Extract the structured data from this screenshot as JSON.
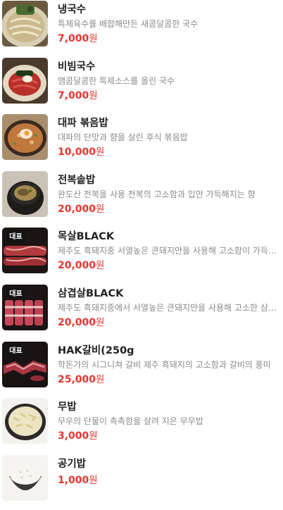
{
  "menu": {
    "items": [
      {
        "name": "냉국수",
        "description": "특제육수를 배합해만든 새콤달콤한 국수",
        "price": "7,000",
        "currency": "원",
        "badge": "",
        "image": "cold-noodle-photo"
      },
      {
        "name": "비빔국수",
        "description": "맴콤달콤한 특제소스를 올린 국수",
        "price": "7,000",
        "currency": "원",
        "badge": "",
        "image": "spicy-noodle-photo"
      },
      {
        "name": "대파 볶음밥",
        "description": "대파의 단맛과 향을 살린 후식 볶음밥",
        "price": "10,000",
        "currency": "원",
        "badge": "",
        "image": "fried-rice-photo"
      },
      {
        "name": "전복솥밥",
        "description": "완도산 전복을 사용 전복의 고소함과 입안 가득해지는 향",
        "price": "20,000",
        "currency": "원",
        "badge": "",
        "image": "abalone-pot-rice-photo"
      },
      {
        "name": "목살BLACK",
        "description": "제주도 흑돼지중 서열높은 큰돼지만을 사용해 고소함이 가득한 목살",
        "price": "20,000",
        "currency": "원",
        "badge": "대표",
        "image": "pork-neck-photo"
      },
      {
        "name": "삼겹살BLACK",
        "description": "제주도 흑돼지중에서 서열높은 큰돼지만을 사용해 고소한 삼겹살",
        "price": "20,000",
        "currency": "원",
        "badge": "대표",
        "image": "pork-belly-photo"
      },
      {
        "name": "HAK갈비(250g",
        "description": "학돈가의 시그니쳐 갈비 제주 흑돼지의 고소함과 갈비의 풍미",
        "price": "25,000",
        "currency": "원",
        "badge": "대표",
        "image": "galbi-photo"
      },
      {
        "name": "무밥",
        "description": "무우의 단물이 촉촉함을 살려 지은 무우밥",
        "price": "3,000",
        "currency": "원",
        "badge": "",
        "image": "radish-rice-photo"
      },
      {
        "name": "공기밥",
        "description": "",
        "price": "1,000",
        "currency": "원",
        "badge": "",
        "image": "steamed-rice-photo"
      }
    ]
  },
  "colors": {
    "price": "#e8342f",
    "name": "#222222",
    "description": "#8a8a8a",
    "badge_bg": "#141414"
  }
}
